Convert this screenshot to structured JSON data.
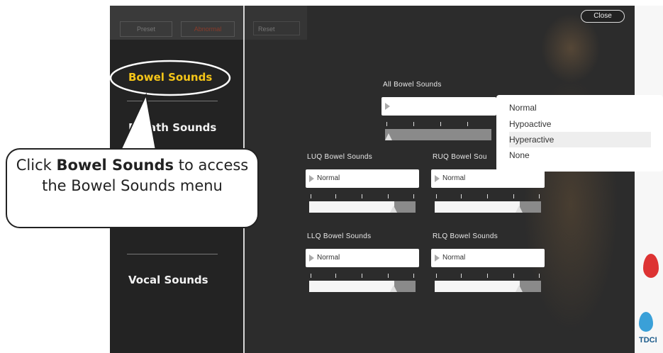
{
  "window": {
    "close_label": "Close"
  },
  "tabs": [
    {
      "label": "Preset"
    },
    {
      "label": "Abnormal"
    },
    {
      "label": "Reset"
    }
  ],
  "sidebar": {
    "items": [
      {
        "label": "Bowel Sounds",
        "active": true
      },
      {
        "label": "Breath Sounds"
      },
      {
        "label": "Vocal Sounds"
      }
    ]
  },
  "controls": {
    "all": {
      "label": "All Bowel Sounds",
      "value": ""
    },
    "luq": {
      "label": "LUQ Bowel Sounds",
      "value": "Normal"
    },
    "ruq": {
      "label": "RUQ Bowel Sou",
      "value": "Normal"
    },
    "llq": {
      "label": "LLQ Bowel Sounds",
      "value": "Normal"
    },
    "rlq": {
      "label": "RLQ Bowel Sounds",
      "value": "Normal"
    }
  },
  "dropdown": {
    "options": [
      "Normal",
      "Hypoactive",
      "Hyperactive",
      "None"
    ],
    "highlighted": "Hyperactive"
  },
  "callout": {
    "pre": "Click ",
    "bold": "Bowel Sounds",
    "post": " to access the Bowel Sounds menu"
  },
  "branding": {
    "logo_text": "TDCI"
  },
  "colors": {
    "accent_active": "#f5c518",
    "panel_bg": "#232323",
    "drop_red": "#dd3333",
    "drop_blue": "#3aa0d8"
  }
}
